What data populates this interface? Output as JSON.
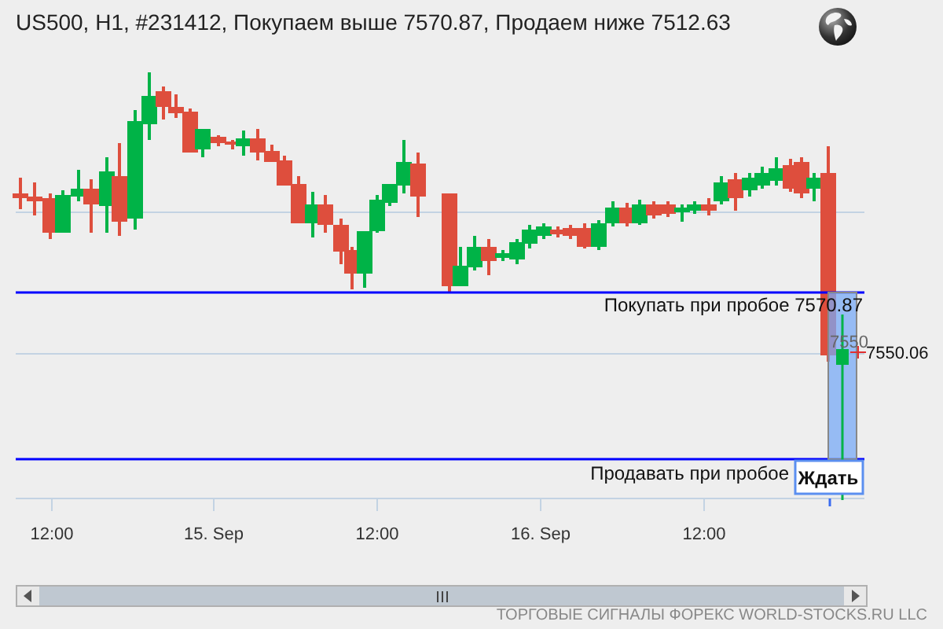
{
  "title": "US500, H1, #231412, Покупаем выше 7570.87, Продаем ниже 7512.63",
  "chart": {
    "buy_line_label": "Покупать при пробое 7570.87",
    "sell_line_label": "Продавать при пробое",
    "price_marker": "7550",
    "current_price": "7550.06",
    "wait_button": "Ждать",
    "x_labels": [
      "12:00",
      "15. Sep",
      "12:00",
      "16. Sep",
      "12:00"
    ]
  },
  "footer": "ТОРГОВЫЕ СИГНАЛЫ ФОРЕКС WORLD-STOCKS.RU LLC"
}
